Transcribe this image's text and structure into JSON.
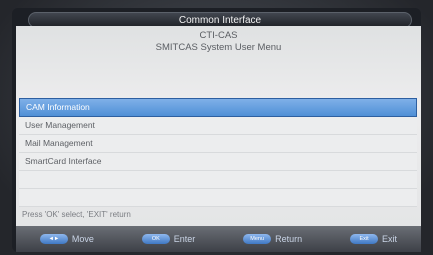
{
  "window": {
    "title": "Common Interface"
  },
  "header": {
    "line1": "CTI-CAS",
    "line2": "SMITCAS System User Menu"
  },
  "menu": {
    "items": [
      {
        "label": "CAM Information",
        "selected": true
      },
      {
        "label": "User Management",
        "selected": false
      },
      {
        "label": "Mail Management",
        "selected": false
      },
      {
        "label": "SmartCard Interface",
        "selected": false
      }
    ]
  },
  "hint": "Press 'OK' select, 'EXIT' return",
  "footer": {
    "move": {
      "key": "◄►",
      "label": "Move"
    },
    "enter": {
      "key": "OK",
      "label": "Enter"
    },
    "return": {
      "key": "Menu",
      "label": "Return"
    },
    "exit": {
      "key": "Exit",
      "label": "Exit"
    }
  },
  "colors": {
    "selection": "#4f8fd6",
    "panel": "#e8e9ea",
    "frame": "#1c1f25"
  }
}
